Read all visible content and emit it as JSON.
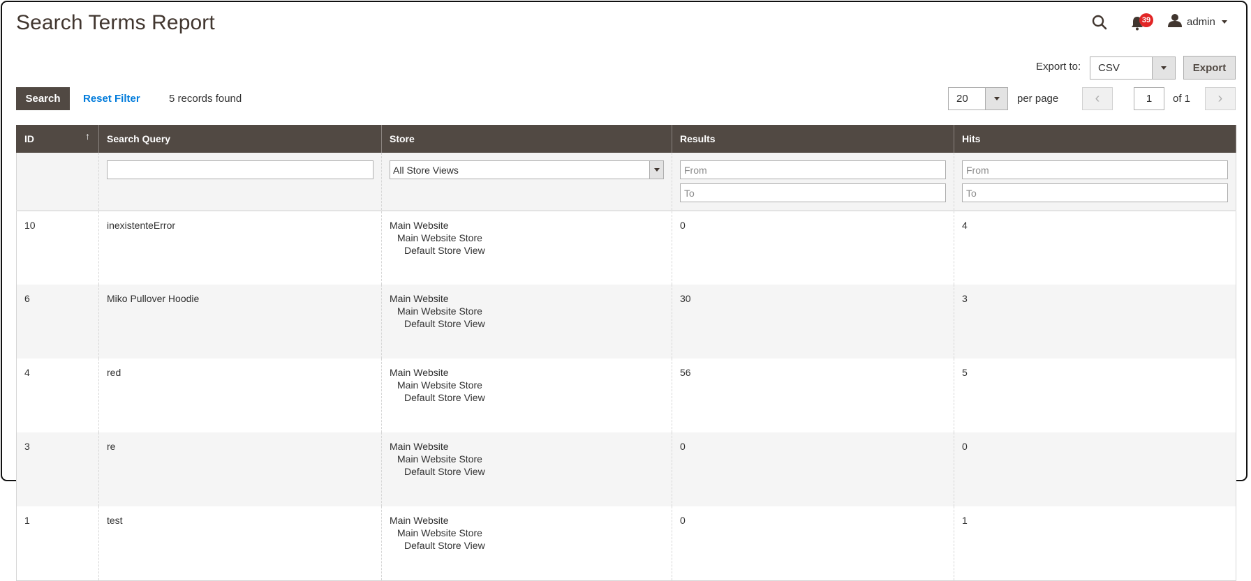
{
  "header": {
    "title": "Search Terms Report",
    "notification_count": "39",
    "user_name": "admin",
    "icons": {
      "search": "search-icon",
      "notifications": "bell-icon",
      "user": "user-icon"
    }
  },
  "export": {
    "label": "Export to:",
    "format": "CSV",
    "button_label": "Export"
  },
  "toolbar": {
    "search_label": "Search",
    "reset_label": "Reset Filter",
    "records_found": "5 records found",
    "per_page_value": "20",
    "per_page_label": "per page",
    "current_page": "1",
    "page_of": "of 1",
    "prev_symbol": "‹",
    "next_symbol": "›"
  },
  "colors": {
    "header_bg": "#514943",
    "link": "#007bdb",
    "badge": "#e22626"
  },
  "grid": {
    "columns": [
      {
        "label": "ID",
        "sort": "↑"
      },
      {
        "label": "Search Query"
      },
      {
        "label": "Store"
      },
      {
        "label": "Results"
      },
      {
        "label": "Hits"
      }
    ],
    "filters": {
      "search_query_value": "",
      "store_value": "All Store Views",
      "results_from_placeholder": "From",
      "results_to_placeholder": "To",
      "hits_from_placeholder": "From",
      "hits_to_placeholder": "To"
    },
    "rows": [
      {
        "id": "10",
        "query": "inexistenteError",
        "store": [
          "Main Website",
          "Main Website Store",
          "Default Store View"
        ],
        "results": "0",
        "hits": "4"
      },
      {
        "id": "6",
        "query": "Miko Pullover Hoodie",
        "store": [
          "Main Website",
          "Main Website Store",
          "Default Store View"
        ],
        "results": "30",
        "hits": "3"
      },
      {
        "id": "4",
        "query": "red",
        "store": [
          "Main Website",
          "Main Website Store",
          "Default Store View"
        ],
        "results": "56",
        "hits": "5"
      },
      {
        "id": "3",
        "query": "re",
        "store": [
          "Main Website",
          "Main Website Store",
          "Default Store View"
        ],
        "results": "0",
        "hits": "0"
      },
      {
        "id": "1",
        "query": "test",
        "store": [
          "Main Website",
          "Main Website Store",
          "Default Store View"
        ],
        "results": "0",
        "hits": "1"
      }
    ]
  }
}
